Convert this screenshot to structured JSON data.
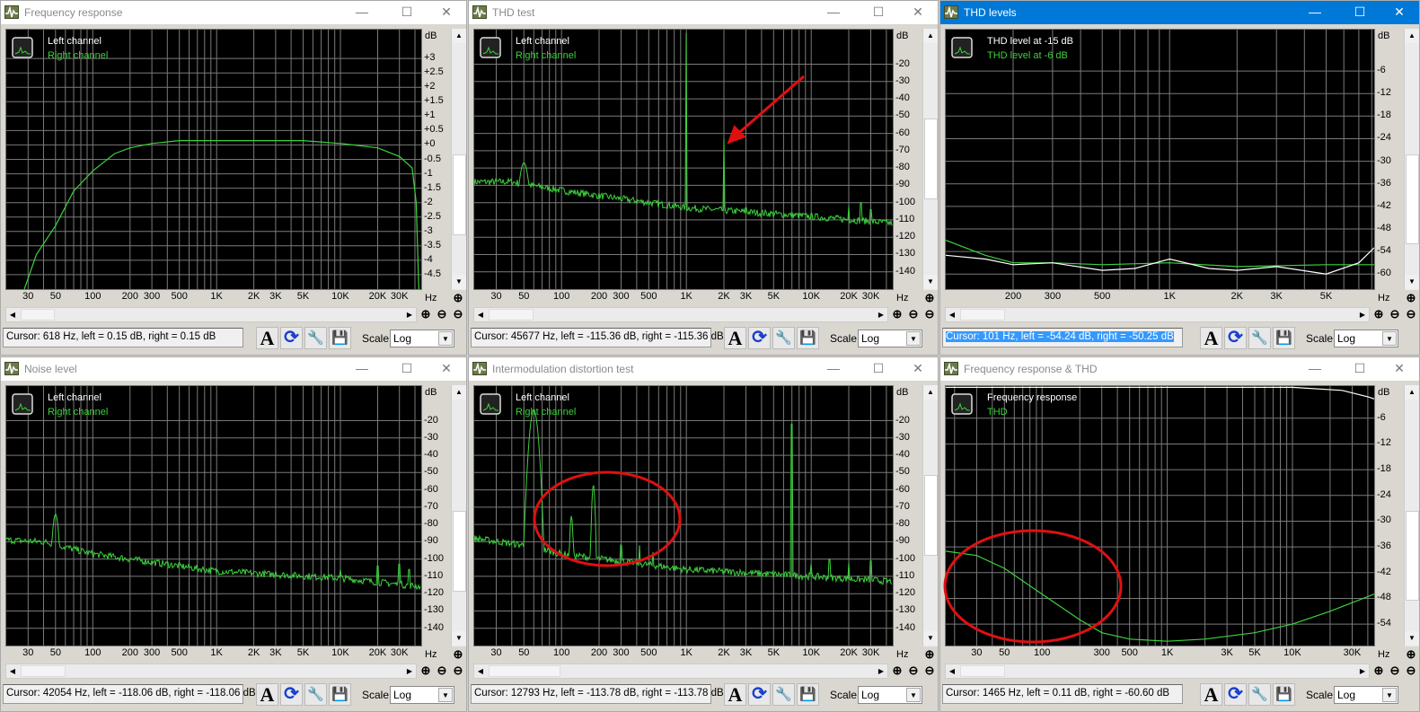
{
  "colors": {
    "green": "#3cd23c",
    "white": "#ffffff",
    "grid": "#7a7a7a",
    "annotation": "#e01010",
    "active_title": "#0078d7"
  },
  "common": {
    "scale_label": "Scale",
    "scale_value": "Log",
    "x_unit": "Hz",
    "y_unit": "dB",
    "minimize": "—",
    "maximize": "☐",
    "close": "✕"
  },
  "windows": [
    {
      "title": "Frequency response",
      "active": false,
      "legend": [
        "Left channel",
        "Right channel"
      ],
      "x_ticks": [
        "30",
        "50",
        "100",
        "200",
        "300",
        "500",
        "1K",
        "2K",
        "3K",
        "5K",
        "10K",
        "20K",
        "30K"
      ],
      "y_ticks": [
        "+3",
        "+2.5",
        "+2",
        "+1.5",
        "+1",
        "+0.5",
        "+0",
        "-0.5",
        "-1",
        "-1.5",
        "-2",
        "-2.5",
        "-3",
        "-3.5",
        "-4",
        "-4.5"
      ],
      "xrange": [
        20,
        45000
      ],
      "yrange": [
        -5,
        4
      ],
      "cursor": "Cursor:  618 Hz,  left = 0.15 dB,  right = 0.15 dB",
      "cursor_selected": false,
      "series": [
        {
          "name": "Right channel",
          "color": "#3cd23c",
          "points": [
            [
              28,
              -5
            ],
            [
              35,
              -3.8
            ],
            [
              50,
              -2.8
            ],
            [
              70,
              -1.6
            ],
            [
              100,
              -0.9
            ],
            [
              150,
              -0.3
            ],
            [
              200,
              -0.1
            ],
            [
              300,
              0.05
            ],
            [
              500,
              0.15
            ],
            [
              5000,
              0.15
            ],
            [
              10000,
              0.05
            ],
            [
              20000,
              -0.1
            ],
            [
              30000,
              -0.4
            ],
            [
              38000,
              -0.8
            ],
            [
              41000,
              -2
            ],
            [
              43000,
              -5
            ]
          ]
        }
      ]
    },
    {
      "title": "THD test",
      "active": false,
      "legend": [
        "Left channel",
        "Right channel"
      ],
      "x_ticks": [
        "30",
        "50",
        "100",
        "200",
        "300",
        "500",
        "1K",
        "2K",
        "3K",
        "5K",
        "10K",
        "20K",
        "30K"
      ],
      "y_ticks": [
        "-20",
        "-30",
        "-40",
        "-50",
        "-60",
        "-70",
        "-80",
        "-90",
        "-100",
        "-110",
        "-120",
        "-130",
        "-140"
      ],
      "xrange": [
        20,
        45000
      ],
      "yrange": [
        -150,
        0
      ],
      "cursor": "Cursor:  45677 Hz,  left = -115.36 dB,  right = -115.36 dB",
      "cursor_selected": false,
      "spectrum": {
        "color": "#3cd23c",
        "floor": [
          [
            20,
            -88
          ],
          [
            40,
            -88
          ],
          [
            100,
            -93
          ],
          [
            1000,
            -103
          ],
          [
            10000,
            -108
          ],
          [
            45000,
            -112
          ]
        ],
        "peaks": [
          {
            "f": 50,
            "db": -77,
            "w": 0.06
          },
          {
            "f": 1000,
            "db": -2,
            "w": 0
          },
          {
            "f": 2000,
            "db": -63,
            "w": 0
          },
          {
            "f": 3000,
            "db": -103,
            "w": 0
          },
          {
            "f": 20000,
            "db": -102,
            "w": 0
          },
          {
            "f": 25000,
            "db": -100,
            "w": 0
          },
          {
            "f": 30000,
            "db": -104,
            "w": 0
          }
        ]
      }
    },
    {
      "title": "THD levels",
      "active": true,
      "legend": [
        "THD level at -15 dB",
        "THD level at -6 dB"
      ],
      "x_ticks": [
        "200",
        "300",
        "500",
        "1K",
        "2K",
        "3K",
        "5K"
      ],
      "y_ticks": [
        "-6",
        "-12",
        "-18",
        "-24",
        "-30",
        "-36",
        "-42",
        "-48",
        "-54",
        "-60"
      ],
      "xrange": [
        100,
        8200
      ],
      "yrange": [
        -64,
        5
      ],
      "cursor": "Cursor:  101 Hz,  left = -54.24 dB,  right = -50.25 dB",
      "cursor_selected": true,
      "series": [
        {
          "name": "THD level at -6 dB",
          "color": "#3cd23c",
          "points": [
            [
              100,
              -51
            ],
            [
              150,
              -55
            ],
            [
              200,
              -57
            ],
            [
              300,
              -57
            ],
            [
              500,
              -57.5
            ],
            [
              1000,
              -57
            ],
            [
              2000,
              -58
            ],
            [
              5000,
              -57.5
            ],
            [
              8200,
              -57.5
            ]
          ]
        },
        {
          "name": "THD level at -15 dB",
          "color": "#ffffff",
          "points": [
            [
              100,
              -55
            ],
            [
              150,
              -56
            ],
            [
              200,
              -57.5
            ],
            [
              300,
              -57
            ],
            [
              500,
              -59
            ],
            [
              700,
              -58.5
            ],
            [
              1000,
              -56
            ],
            [
              1500,
              -58.5
            ],
            [
              2000,
              -59
            ],
            [
              3000,
              -58
            ],
            [
              5000,
              -60
            ],
            [
              7000,
              -57
            ],
            [
              8200,
              -53
            ]
          ]
        }
      ]
    },
    {
      "title": "Noise level",
      "active": false,
      "legend": [
        "Left channel",
        "Right channel"
      ],
      "x_ticks": [
        "30",
        "50",
        "100",
        "200",
        "300",
        "500",
        "1K",
        "2K",
        "3K",
        "5K",
        "10K",
        "20K",
        "30K"
      ],
      "y_ticks": [
        "-20",
        "-30",
        "-40",
        "-50",
        "-60",
        "-70",
        "-80",
        "-90",
        "-100",
        "-110",
        "-120",
        "-130",
        "-140"
      ],
      "xrange": [
        20,
        45000
      ],
      "yrange": [
        -150,
        0
      ],
      "cursor": "Cursor:  42054 Hz,  left = -118.06 dB,  right = -118.06 dB",
      "cursor_selected": false,
      "spectrum": {
        "color": "#3cd23c",
        "floor": [
          [
            20,
            -89
          ],
          [
            40,
            -90
          ],
          [
            100,
            -97
          ],
          [
            1000,
            -107
          ],
          [
            10000,
            -111
          ],
          [
            45000,
            -116
          ]
        ],
        "peaks": [
          {
            "f": 50,
            "db": -74,
            "w": 0.04
          },
          {
            "f": 3000,
            "db": -107,
            "w": 0
          },
          {
            "f": 10000,
            "db": -106,
            "w": 0
          },
          {
            "f": 20000,
            "db": -104,
            "w": 0
          },
          {
            "f": 30000,
            "db": -103,
            "w": 0
          },
          {
            "f": 36000,
            "db": -106,
            "w": 0
          }
        ]
      }
    },
    {
      "title": "Intermodulation distortion test",
      "active": false,
      "legend": [
        "Left channel",
        "Right channel"
      ],
      "x_ticks": [
        "30",
        "50",
        "100",
        "200",
        "300",
        "500",
        "1K",
        "2K",
        "3K",
        "5K",
        "10K",
        "20K",
        "30K"
      ],
      "y_ticks": [
        "-20",
        "-30",
        "-40",
        "-50",
        "-60",
        "-70",
        "-80",
        "-90",
        "-100",
        "-110",
        "-120",
        "-130",
        "-140"
      ],
      "xrange": [
        20,
        45000
      ],
      "yrange": [
        -150,
        0
      ],
      "cursor": "Cursor:  12793 Hz,  left = -113.78 dB,  right = -113.78 dB",
      "cursor_selected": false,
      "spectrum": {
        "color": "#3cd23c",
        "floor": [
          [
            20,
            -88
          ],
          [
            50,
            -92
          ],
          [
            100,
            -97
          ],
          [
            1000,
            -106
          ],
          [
            10000,
            -110
          ],
          [
            45000,
            -113
          ]
        ],
        "peaks": [
          {
            "f": 60,
            "db": -14,
            "w": 0.05
          },
          {
            "f": 120,
            "db": -75,
            "w": 0.02
          },
          {
            "f": 180,
            "db": -57,
            "w": 0.02
          },
          {
            "f": 300,
            "db": -88,
            "w": 0.01
          },
          {
            "f": 420,
            "db": -92,
            "w": 0
          },
          {
            "f": 540,
            "db": -96,
            "w": 0
          },
          {
            "f": 7000,
            "db": -22,
            "w": 0
          },
          {
            "f": 10000,
            "db": -103,
            "w": 0
          },
          {
            "f": 14000,
            "db": -100,
            "w": 0
          },
          {
            "f": 20000,
            "db": -102,
            "w": 0
          },
          {
            "f": 30000,
            "db": -101,
            "w": 0
          }
        ]
      }
    },
    {
      "title": "Frequency response & THD",
      "active": false,
      "legend": [
        "Frequency response",
        "THD"
      ],
      "x_ticks": [
        "30",
        "50",
        "100",
        "300",
        "500",
        "1K",
        "3K",
        "5K",
        "10K",
        "30K"
      ],
      "y_ticks": [
        "-6",
        "-12",
        "-18",
        "-24",
        "-30",
        "-36",
        "-42",
        "-48",
        "-54"
      ],
      "xrange": [
        17,
        45000
      ],
      "yrange": [
        -59,
        1.5
      ],
      "cursor": "Cursor:  1465 Hz,  left = 0.11 dB,  right = -60.60 dB",
      "cursor_selected": false,
      "series": [
        {
          "name": "Frequency response",
          "color": "#ffffff",
          "points": [
            [
              17,
              1.2
            ],
            [
              10000,
              1.2
            ],
            [
              25000,
              0.5
            ],
            [
              40000,
              -1
            ],
            [
              45000,
              -1.5
            ]
          ]
        },
        {
          "name": "THD",
          "color": "#3cd23c",
          "points": [
            [
              17,
              -37
            ],
            [
              30,
              -38
            ],
            [
              50,
              -41
            ],
            [
              100,
              -47
            ],
            [
              200,
              -53
            ],
            [
              300,
              -56
            ],
            [
              500,
              -57.5
            ],
            [
              1000,
              -58
            ],
            [
              2000,
              -57.5
            ],
            [
              5000,
              -56
            ],
            [
              10000,
              -54
            ],
            [
              20000,
              -51
            ],
            [
              45000,
              -47
            ]
          ]
        }
      ]
    }
  ]
}
